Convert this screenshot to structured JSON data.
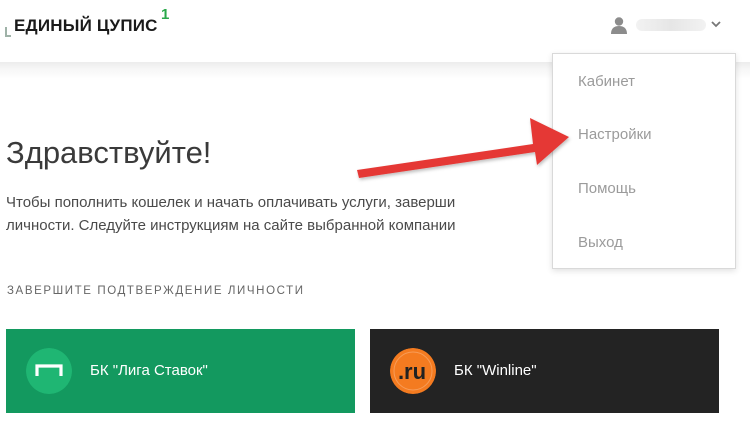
{
  "header": {
    "logo_text": "ЕДИНЫЙ ЦУПИС",
    "logo_superscript": "1"
  },
  "user_menu": {
    "items": [
      {
        "label": "Кабинет"
      },
      {
        "label": "Настройки"
      },
      {
        "label": "Помощь"
      },
      {
        "label": "Выход"
      }
    ]
  },
  "main": {
    "greeting": "Здравствуйте!",
    "intro_line1": "Чтобы пополнить кошелек и начать оплачивать услуги, заверши",
    "intro_line2": "личности. Следуйте инструкциям на сайте выбранной компании",
    "section_title": "ЗАВЕРШИТЕ ПОДТВЕРЖДЕНИЕ ЛИЧНОСТИ"
  },
  "cards": [
    {
      "label": "БК \"Лига Ставок\"",
      "color": "#13995f"
    },
    {
      "label": "БК \"Winline\"",
      "color": "#232323",
      "logo_text": ".ru"
    }
  ],
  "colors": {
    "accent_green": "#13995f",
    "logo_superscript": "#2aa84a",
    "annotation_arrow": "#e53935",
    "winline_logo": "#f47b20"
  },
  "icons": [
    "user-icon",
    "chevron-down-icon",
    "liga-stavok-logo",
    "winline-logo"
  ]
}
